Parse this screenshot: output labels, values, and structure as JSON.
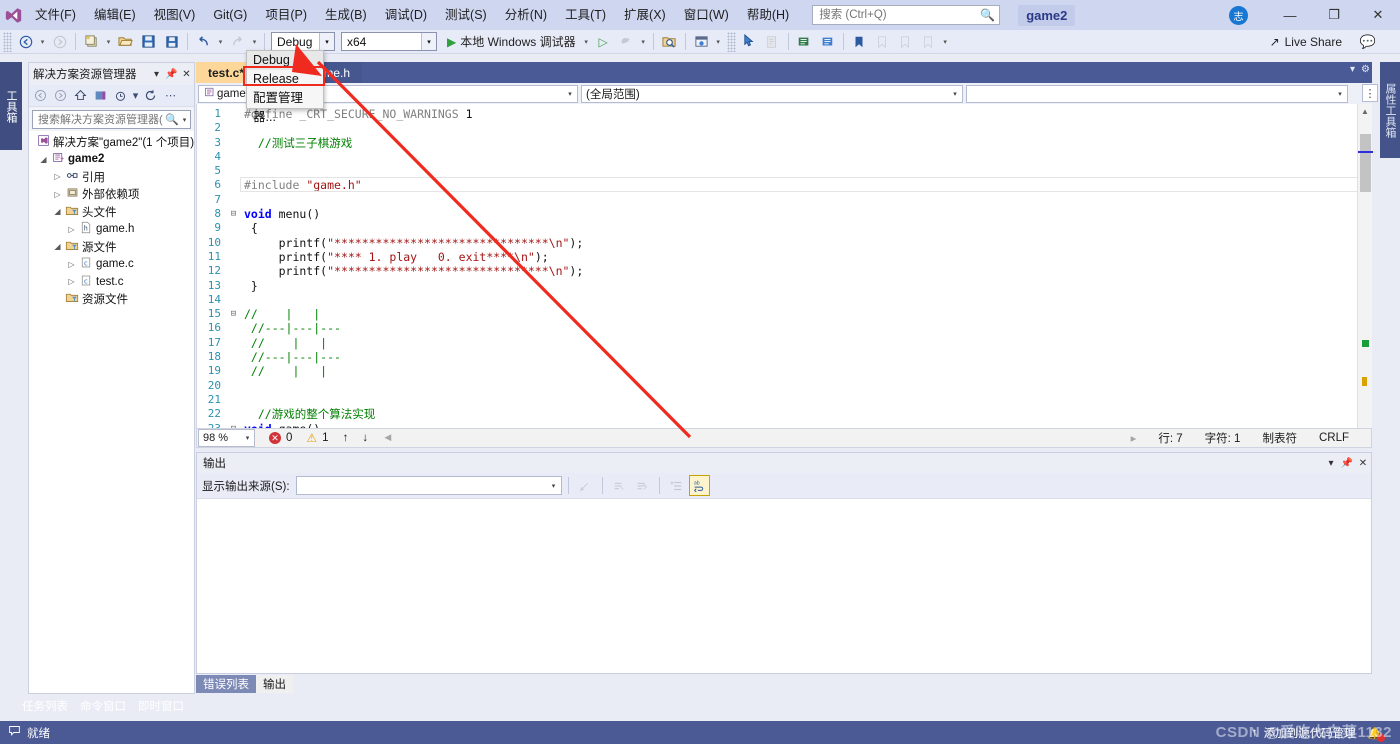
{
  "titlebar": {
    "logo_icon": "visual-studio-logo-icon",
    "menus": [
      {
        "label": "文件(F)"
      },
      {
        "label": "编辑(E)"
      },
      {
        "label": "视图(V)"
      },
      {
        "label": "Git(G)"
      },
      {
        "label": "项目(P)"
      },
      {
        "label": "生成(B)"
      },
      {
        "label": "调试(D)"
      },
      {
        "label": "测试(S)"
      },
      {
        "label": "分析(N)"
      },
      {
        "label": "工具(T)"
      },
      {
        "label": "扩展(X)"
      },
      {
        "label": "窗口(W)"
      },
      {
        "label": "帮助(H)"
      }
    ],
    "search_placeholder": "搜索 (Ctrl+Q)",
    "search_value": "",
    "search_icon": "search-icon",
    "project_name": "game2",
    "account_initial": "志",
    "minimize": "—",
    "maximize": "❐",
    "close": "✕"
  },
  "toolbar": {
    "nav_back": "◄",
    "nav_forward": "►",
    "new_project": "new-project-icon",
    "open_file": "open-file-icon",
    "save": "save-icon",
    "save_all": "save-all-icon",
    "undo": "undo-icon",
    "redo": "redo-icon",
    "configuration": "Debug",
    "platform": "x64",
    "debug_target": "本地 Windows 调试器",
    "live_share_label": "Live Share",
    "live_share_icon": "live-share-icon",
    "feedback_icon": "feedback-icon"
  },
  "config_dropdown": {
    "open": true,
    "items": [
      {
        "label": "Debug",
        "highlighted": true
      },
      {
        "label": "Release",
        "highlighted": false
      },
      {
        "label": "配置管理器...",
        "highlighted": false
      }
    ],
    "highlight_target": "Release",
    "highlight_color": "#ef2a1f"
  },
  "solution_explorer": {
    "title": "解决方案资源管理器",
    "dropdown_icon": "chevron-down-icon",
    "pin_icon": "pin-icon",
    "close_icon": "close-icon",
    "toolbar_icons": [
      "back-icon",
      "forward-icon",
      "home-icon",
      "sync-with-active-document-icon",
      "pending-changes-filter-icon",
      "refresh-icon",
      "overflow-icon"
    ],
    "search_placeholder": "搜索解决方案资源管理器(Ctrl+;)",
    "search_value": "",
    "tree": [
      {
        "label": "解决方案\"game2\"(1 个项目)",
        "icon": "solution-icon",
        "depth": 0,
        "twisty": "",
        "bold": false
      },
      {
        "label": "game2",
        "icon": "cpp-project-icon",
        "depth": 1,
        "twisty": "▲",
        "bold": true
      },
      {
        "label": "引用",
        "icon": "references-icon",
        "depth": 2,
        "twisty": "▷",
        "bold": false
      },
      {
        "label": "外部依赖项",
        "icon": "external-deps-icon",
        "depth": 2,
        "twisty": "▷",
        "bold": false
      },
      {
        "label": "头文件",
        "icon": "filter-folder-icon",
        "depth": 2,
        "twisty": "▲",
        "bold": false
      },
      {
        "label": "game.h",
        "icon": "header-file-icon",
        "depth": 3,
        "twisty": "▷",
        "bold": false
      },
      {
        "label": "源文件",
        "icon": "filter-folder-icon",
        "depth": 2,
        "twisty": "▲",
        "bold": false
      },
      {
        "label": "game.c",
        "icon": "c-file-icon",
        "depth": 3,
        "twisty": "▷",
        "bold": false
      },
      {
        "label": "test.c",
        "icon": "c-file-icon",
        "depth": 3,
        "twisty": "▷",
        "bold": false
      },
      {
        "label": "资源文件",
        "icon": "filter-folder-icon",
        "depth": 2,
        "twisty": "",
        "bold": false
      }
    ]
  },
  "editor": {
    "tabs": [
      {
        "label": "test.c*",
        "active": true
      },
      {
        "label": "game.h",
        "active": false
      }
    ],
    "navbar": {
      "member_icon": "cpp-project-icon",
      "member": "game2",
      "scope": "(全局范围)",
      "third": ""
    },
    "code_lines": [
      {
        "n": 1,
        "fold": "",
        "tokens": [
          {
            "t": "#define ",
            "c": "pre"
          },
          {
            "t": "_CRT_SECURE_NO_WARNINGS ",
            "c": "pre"
          },
          {
            "t": "1",
            "c": "num"
          }
        ]
      },
      {
        "n": 2,
        "fold": "",
        "tokens": []
      },
      {
        "n": 3,
        "fold": "",
        "tokens": [
          {
            "t": "  //测试三子棋游戏",
            "c": "cmt"
          }
        ]
      },
      {
        "n": 4,
        "fold": "",
        "tokens": []
      },
      {
        "n": 5,
        "fold": "",
        "tokens": []
      },
      {
        "n": 6,
        "fold": "",
        "tokens": [
          {
            "t": "#include ",
            "c": "pre"
          },
          {
            "t": "\"game.h\"",
            "c": "str"
          }
        ]
      },
      {
        "n": 7,
        "fold": "",
        "tokens": []
      },
      {
        "n": 8,
        "fold": "−",
        "tokens": [
          {
            "t": "void",
            "c": "kw"
          },
          {
            "t": " menu()",
            "c": "fn"
          }
        ]
      },
      {
        "n": 9,
        "fold": "",
        "tokens": [
          {
            "t": " {",
            "c": "fn"
          }
        ]
      },
      {
        "n": 10,
        "fold": "",
        "tokens": [
          {
            "t": "     printf(",
            "c": "fn"
          },
          {
            "t": "\"*******************************\\n\"",
            "c": "str"
          },
          {
            "t": ");",
            "c": "fn"
          }
        ]
      },
      {
        "n": 11,
        "fold": "",
        "tokens": [
          {
            "t": "     printf(",
            "c": "fn"
          },
          {
            "t": "\"**** 1. play   0. exit****\\n\"",
            "c": "str"
          },
          {
            "t": ");",
            "c": "fn"
          }
        ]
      },
      {
        "n": 12,
        "fold": "",
        "tokens": [
          {
            "t": "     printf(",
            "c": "fn"
          },
          {
            "t": "\"*******************************\\n\"",
            "c": "str"
          },
          {
            "t": ");",
            "c": "fn"
          }
        ]
      },
      {
        "n": 13,
        "fold": "",
        "tokens": [
          {
            "t": " }",
            "c": "fn"
          }
        ]
      },
      {
        "n": 14,
        "fold": "",
        "tokens": []
      },
      {
        "n": 15,
        "fold": "−",
        "tokens": [
          {
            "t": "//    |   |",
            "c": "cmt"
          }
        ]
      },
      {
        "n": 16,
        "fold": "",
        "tokens": [
          {
            "t": " //---|---|---",
            "c": "cmt"
          }
        ]
      },
      {
        "n": 17,
        "fold": "",
        "tokens": [
          {
            "t": " //    |   |",
            "c": "cmt"
          }
        ]
      },
      {
        "n": 18,
        "fold": "",
        "tokens": [
          {
            "t": " //---|---|---",
            "c": "cmt"
          }
        ]
      },
      {
        "n": 19,
        "fold": "",
        "tokens": [
          {
            "t": " //    |   |",
            "c": "cmt"
          }
        ]
      },
      {
        "n": 20,
        "fold": "",
        "tokens": []
      },
      {
        "n": 21,
        "fold": "",
        "tokens": []
      },
      {
        "n": 22,
        "fold": "",
        "tokens": [
          {
            "t": "  //游戏的整个算法实现",
            "c": "cmt"
          }
        ]
      },
      {
        "n": 23,
        "fold": "−",
        "tokens": [
          {
            "t": "void",
            "c": "kw"
          },
          {
            "t": " game()",
            "c": "fn"
          }
        ]
      }
    ]
  },
  "editor_status": {
    "zoom": "98 %",
    "error_count": "0",
    "warning_count": "1",
    "prev_icon": "arrow-up-icon",
    "next_icon": "arrow-down-icon",
    "line": "行: 7",
    "column": "字符: 1",
    "tabs_mode": "制表符",
    "line_ending": "CRLF"
  },
  "output_panel": {
    "title": "输出",
    "source_label": "显示输出来源(S):",
    "source_value": "",
    "toolbar_icons": [
      "locate-icon",
      "clear-all-icon",
      "go-to-next-icon",
      "toggle-wordwrap-list-icon",
      "word-wrap-icon"
    ],
    "body_text": ""
  },
  "bottom_tabs": [
    {
      "label": "错误列表",
      "state": "sel"
    },
    {
      "label": "输出",
      "state": "cur"
    }
  ],
  "left_tool_tabs": [
    {
      "label": "任务列表"
    },
    {
      "label": "命令窗口"
    },
    {
      "label": "即时窗口"
    }
  ],
  "dock_tabs": {
    "left_vertical": "工具箱",
    "right_vertical": "属性工具箱"
  },
  "statusbar": {
    "ready_text": "就绪",
    "ready_icon": "speech-bubble-icon",
    "scm_text": "添加到源代码管理",
    "scm_icon": "arrow-up-icon",
    "bell_icon": "notification-bell-icon"
  },
  "watermark": "CSDN @爱吃大白菜1132",
  "colors": {
    "titlebar_bg": "#cfd6ef",
    "toolbar_bg": "#e7ebf7",
    "tabstrip_bg": "#4a5a96",
    "active_tab_bg": "#fcd799",
    "statusbar_bg": "#4b5a94",
    "comment_green": "#008000",
    "string_red": "#a31515",
    "keyword_blue": "#0000ff",
    "linenumber_teal": "#2b91af",
    "annotation_red": "#ef2a1f"
  }
}
